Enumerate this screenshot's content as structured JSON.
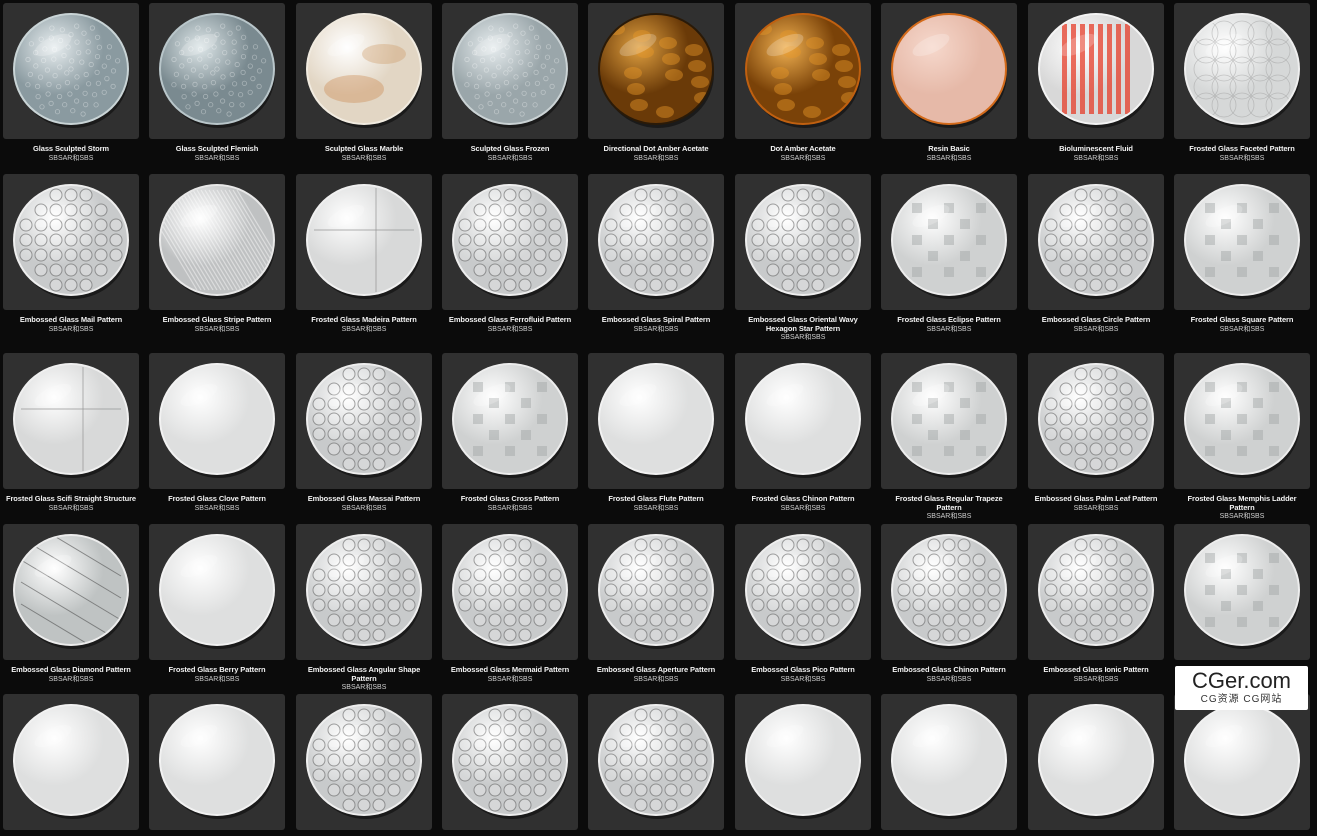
{
  "materials": [
    {
      "name": "Glass Sculpted Storm",
      "format": "SBSAR和SBS",
      "style": "storm"
    },
    {
      "name": "Glass Sculpted Flemish",
      "format": "SBSAR和SBS",
      "style": "flemish"
    },
    {
      "name": "Sculpted Glass Marble",
      "format": "SBSAR和SBS",
      "style": "marble"
    },
    {
      "name": "Sculpted Glass Frozen",
      "format": "SBSAR和SBS",
      "style": "frozen"
    },
    {
      "name": "Directional Dot Amber Acetate",
      "format": "SBSAR和SBS",
      "style": "amber-dir"
    },
    {
      "name": "Dot Amber Acetate",
      "format": "SBSAR和SBS",
      "style": "amber-dot"
    },
    {
      "name": "Resin Basic",
      "format": "SBSAR和SBS",
      "style": "resin"
    },
    {
      "name": "Bioluminescent Fluid",
      "format": "SBSAR和SBS",
      "style": "bio"
    },
    {
      "name": "Frosted Glass Faceted Pattern",
      "format": "SBSAR和SBS",
      "style": "faceted"
    },
    {
      "name": "Embossed Glass Mail Pattern",
      "format": "SBSAR和SBS",
      "style": "embossed"
    },
    {
      "name": "Embossed Glass Stripe Pattern",
      "format": "SBSAR和SBS",
      "style": "stripe"
    },
    {
      "name": "Frosted Glass Madeira Pattern",
      "format": "SBSAR和SBS",
      "style": "frosted-lines"
    },
    {
      "name": "Embossed Glass Ferrofluid Pattern",
      "format": "SBSAR和SBS",
      "style": "embossed"
    },
    {
      "name": "Embossed Glass Spiral Pattern",
      "format": "SBSAR和SBS",
      "style": "embossed"
    },
    {
      "name": "Embossed Glass Oriental Wavy Hexagon Star Pattern",
      "format": "SBSAR和SBS",
      "style": "embossed"
    },
    {
      "name": "Frosted Glass Eclipse Pattern",
      "format": "SBSAR和SBS",
      "style": "frosted-pattern"
    },
    {
      "name": "Embossed Glass Circle Pattern",
      "format": "SBSAR和SBS",
      "style": "embossed"
    },
    {
      "name": "Frosted Glass Square Pattern",
      "format": "SBSAR和SBS",
      "style": "frosted-pattern"
    },
    {
      "name": "Frosted Glass Scifi Straight Structure",
      "format": "SBSAR和SBS",
      "style": "frosted-lines"
    },
    {
      "name": "Frosted Glass Clove Pattern",
      "format": "SBSAR和SBS",
      "style": "frosted"
    },
    {
      "name": "Embossed Glass Massai Pattern",
      "format": "SBSAR和SBS",
      "style": "embossed"
    },
    {
      "name": "Frosted Glass Cross Pattern",
      "format": "SBSAR和SBS",
      "style": "frosted-pattern"
    },
    {
      "name": "Frosted Glass Flute Pattern",
      "format": "SBSAR和SBS",
      "style": "frosted"
    },
    {
      "name": "Frosted Glass Chinon Pattern",
      "format": "SBSAR和SBS",
      "style": "frosted"
    },
    {
      "name": "Frosted Glass Regular Trapeze Pattern",
      "format": "SBSAR和SBS",
      "style": "frosted-pattern"
    },
    {
      "name": "Embossed Glass Palm Leaf Pattern",
      "format": "SBSAR和SBS",
      "style": "embossed"
    },
    {
      "name": "Frosted Glass Memphis Ladder Pattern",
      "format": "SBSAR和SBS",
      "style": "frosted-pattern"
    },
    {
      "name": "Embossed Glass Diamond Pattern",
      "format": "SBSAR和SBS",
      "style": "diamond"
    },
    {
      "name": "Frosted Glass Berry Pattern",
      "format": "SBSAR和SBS",
      "style": "frosted"
    },
    {
      "name": "Embossed Glass Angular Shape Pattern",
      "format": "SBSAR和SBS",
      "style": "embossed"
    },
    {
      "name": "Embossed Glass Mermaid Pattern",
      "format": "SBSAR和SBS",
      "style": "embossed"
    },
    {
      "name": "Embossed Glass Aperture Pattern",
      "format": "SBSAR和SBS",
      "style": "embossed"
    },
    {
      "name": "Embossed Glass Pico Pattern",
      "format": "SBSAR和SBS",
      "style": "embossed"
    },
    {
      "name": "Embossed Glass Chinon Pattern",
      "format": "SBSAR和SBS",
      "style": "embossed"
    },
    {
      "name": "Embossed Glass Ionic Pattern",
      "format": "SBSAR和SBS",
      "style": "embossed"
    },
    {
      "name": "",
      "format": "",
      "style": "frosted-pattern"
    },
    {
      "name": "",
      "format": "",
      "style": "frosted"
    },
    {
      "name": "",
      "format": "",
      "style": "frosted"
    },
    {
      "name": "",
      "format": "",
      "style": "embossed"
    },
    {
      "name": "",
      "format": "",
      "style": "embossed"
    },
    {
      "name": "",
      "format": "",
      "style": "embossed"
    },
    {
      "name": "",
      "format": "",
      "style": "frosted"
    },
    {
      "name": "",
      "format": "",
      "style": "frosted"
    },
    {
      "name": "",
      "format": "",
      "style": "frosted"
    },
    {
      "name": "",
      "format": "",
      "style": "frosted"
    }
  ],
  "watermark": {
    "main": "CGer.com",
    "sub": "CG资源 CG网站"
  }
}
